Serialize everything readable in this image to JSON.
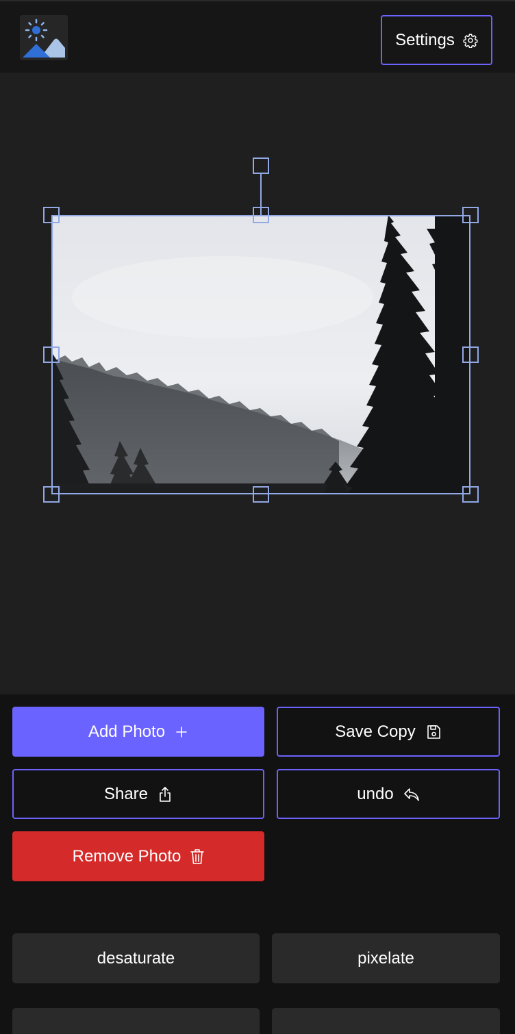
{
  "header": {
    "logo_icon": "sun-mountain-logo-icon",
    "settings_label": "Settings",
    "settings_icon": "gear-icon"
  },
  "editor": {
    "photo_alt": "Misty forest with pine trees"
  },
  "actions": {
    "add_photo": {
      "label": "Add Photo",
      "icon": "plus-icon"
    },
    "save_copy": {
      "label": "Save Copy",
      "icon": "floppy-disk-icon"
    },
    "share": {
      "label": "Share",
      "icon": "share-icon"
    },
    "undo": {
      "label": "undo",
      "icon": "undo-arrow-icon"
    },
    "remove_photo": {
      "label": "Remove Photo",
      "icon": "trash-icon"
    }
  },
  "filters": [
    {
      "label": "desaturate"
    },
    {
      "label": "pixelate"
    },
    {
      "label": ""
    },
    {
      "label": ""
    }
  ],
  "colors": {
    "accent": "#6b63ff",
    "danger": "#d42a2a",
    "selection": "#93a9e6",
    "background": "#1f1f1f"
  }
}
